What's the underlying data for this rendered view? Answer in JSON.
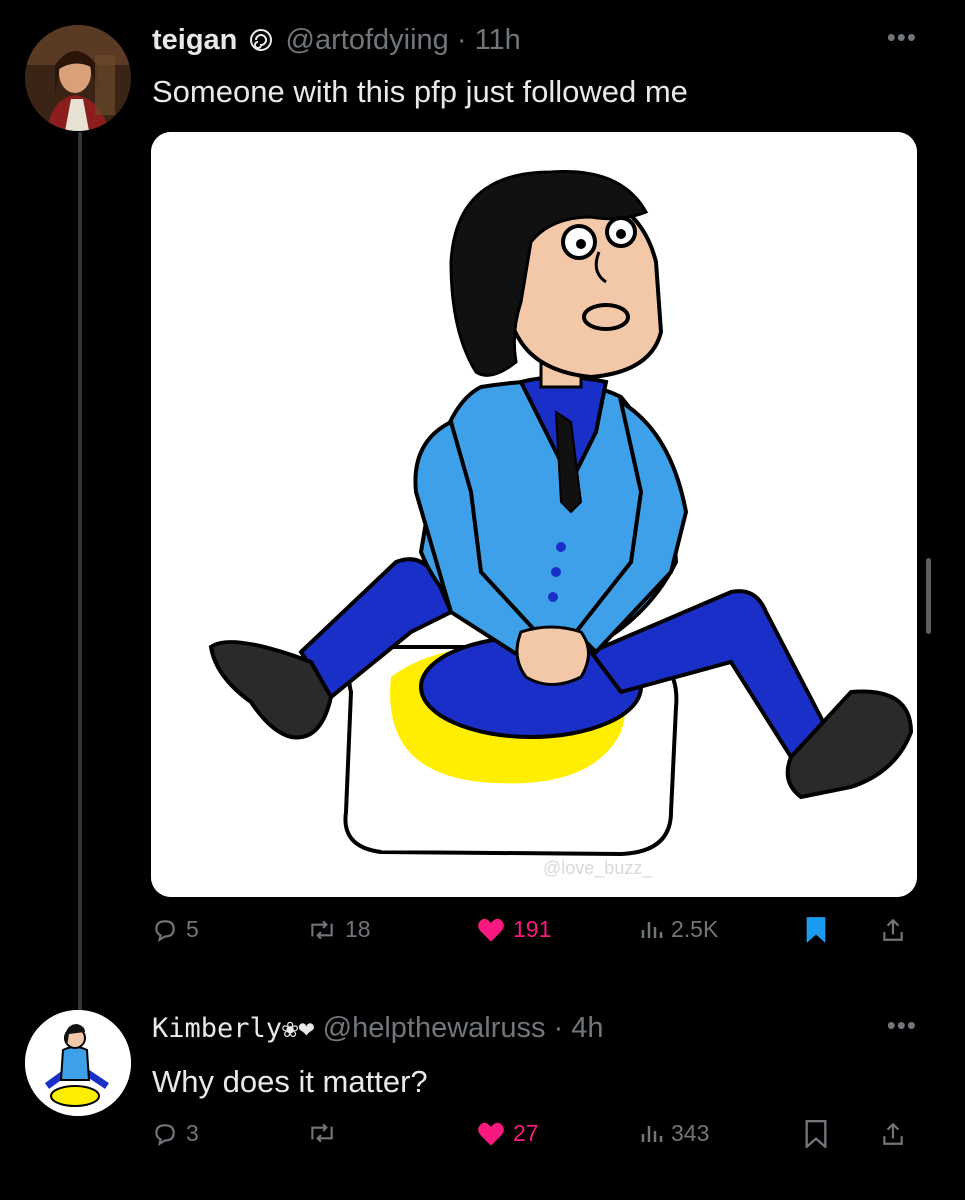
{
  "tweet": {
    "author_name": "teigan",
    "handle": "@artofdyiing",
    "time": "11h",
    "text": "Someone with this pfp just followed me",
    "image_watermark": "@love_buzz_",
    "stats": {
      "replies": "5",
      "reposts": "18",
      "likes": "191",
      "views": "2.5K"
    },
    "bookmarked": true,
    "liked": true
  },
  "reply": {
    "author_name": "Kimberly❀❤",
    "handle": "@helpthewalruss",
    "time": "4h",
    "text": "Why does it matter?",
    "stats": {
      "replies": "3",
      "reposts": "",
      "likes": "27",
      "views": "343"
    },
    "bookmarked": false,
    "liked": true
  },
  "colors": {
    "like": "#f91880",
    "bookmark": "#1d9bf0",
    "muted": "#71767b"
  },
  "icons": [
    "reply-icon",
    "repost-icon",
    "heart-icon",
    "views-icon",
    "bookmark-icon",
    "share-icon",
    "more-icon",
    "verified-spiral-icon"
  ]
}
